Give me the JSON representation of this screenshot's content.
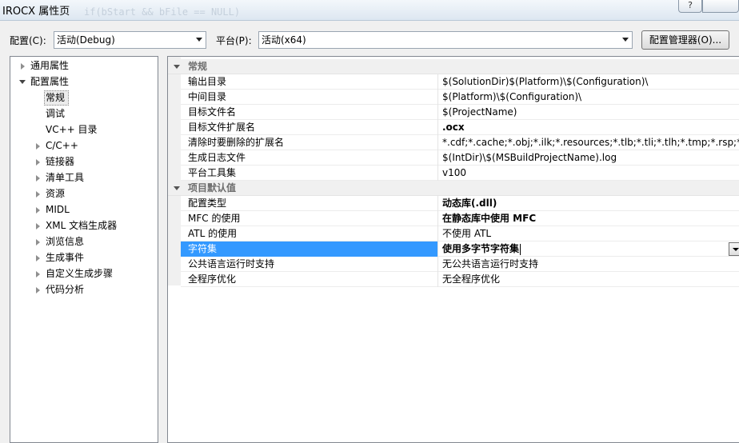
{
  "window": {
    "title": "IROCX 属性页",
    "background_text": "if(bStart && bFile == NULL)",
    "help_label": "?"
  },
  "config_row": {
    "config_label": "配置(C):",
    "config_value": "活动(Debug)",
    "platform_label": "平台(P):",
    "platform_value": "活动(x64)",
    "manager_button": "配置管理器(O)..."
  },
  "tree": {
    "items": [
      {
        "label": "通用属性",
        "level": 0,
        "state": "collapsed"
      },
      {
        "label": "配置属性",
        "level": 0,
        "state": "expanded"
      },
      {
        "label": "常规",
        "level": 1,
        "state": "leaf"
      },
      {
        "label": "调试",
        "level": 1,
        "state": "leaf"
      },
      {
        "label": "VC++ 目录",
        "level": 1,
        "state": "leaf"
      },
      {
        "label": "C/C++",
        "level": 1,
        "state": "collapsed"
      },
      {
        "label": "链接器",
        "level": 1,
        "state": "collapsed"
      },
      {
        "label": "清单工具",
        "level": 1,
        "state": "collapsed"
      },
      {
        "label": "资源",
        "level": 1,
        "state": "collapsed"
      },
      {
        "label": "MIDL",
        "level": 1,
        "state": "collapsed"
      },
      {
        "label": "XML 文档生成器",
        "level": 1,
        "state": "collapsed"
      },
      {
        "label": "浏览信息",
        "level": 1,
        "state": "collapsed"
      },
      {
        "label": "生成事件",
        "level": 1,
        "state": "collapsed"
      },
      {
        "label": "自定义生成步骤",
        "level": 1,
        "state": "collapsed"
      },
      {
        "label": "代码分析",
        "level": 1,
        "state": "collapsed"
      }
    ],
    "selected": "常规"
  },
  "grid": {
    "categories": [
      {
        "label": "常规"
      },
      {
        "label": "项目默认值"
      }
    ],
    "general_props": [
      {
        "name": "输出目录",
        "value": "$(SolutionDir)$(Platform)\\$(Configuration)\\",
        "bold": false
      },
      {
        "name": "中间目录",
        "value": "$(Platform)\\$(Configuration)\\",
        "bold": false
      },
      {
        "name": "目标文件名",
        "value": "$(ProjectName)",
        "bold": false
      },
      {
        "name": "目标文件扩展名",
        "value": ".ocx",
        "bold": true
      },
      {
        "name": "清除时要删除的扩展名",
        "value": "*.cdf;*.cache;*.obj;*.ilk;*.resources;*.tlb;*.tli;*.tlh;*.tmp;*.rsp;*.pgc",
        "bold": false
      },
      {
        "name": "生成日志文件",
        "value": "$(IntDir)\\$(MSBuildProjectName).log",
        "bold": false
      },
      {
        "name": "平台工具集",
        "value": "v100",
        "bold": false
      }
    ],
    "default_props": [
      {
        "name": "配置类型",
        "value": "动态库(.dll)",
        "bold": true
      },
      {
        "name": "MFC 的使用",
        "value": "在静态库中使用 MFC",
        "bold": true
      },
      {
        "name": "ATL 的使用",
        "value": "不使用 ATL",
        "bold": false
      },
      {
        "name": "字符集",
        "value": "使用多字节字符集",
        "bold": true,
        "selected": true
      },
      {
        "name": "公共语言运行时支持",
        "value": "无公共语言运行时支持",
        "bold": false
      },
      {
        "name": "全程序优化",
        "value": "无全程序优化",
        "bold": false
      }
    ]
  },
  "colors": {
    "selection": "#3399ff",
    "category_bg": "#f0f0f0"
  }
}
